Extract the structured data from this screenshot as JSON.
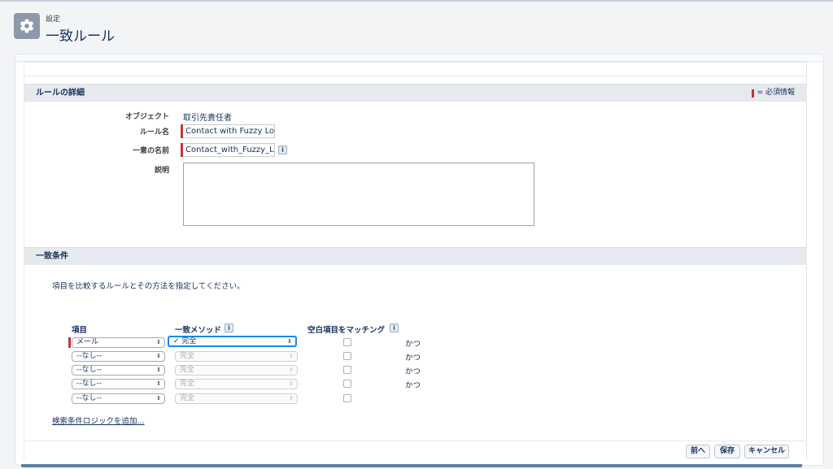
{
  "header": {
    "small": "設定",
    "title": "一致ルール"
  },
  "details_section": {
    "title": "ルールの詳細",
    "required_legend": "= 必須情報",
    "fields": {
      "object_label": "オブジェクト",
      "object_value": "取引先責任者",
      "rule_name_label": "ルール名",
      "rule_name_value": "Contact with Fuzzy Logic",
      "unique_name_label": "一意の名前",
      "unique_name_value": "Contact_with_Fuzzy_Logic",
      "description_label": "説明",
      "description_value": ""
    }
  },
  "criteria_section": {
    "title": "一致条件",
    "instruction": "項目を比較するルールとその方法を指定してください。",
    "columns": {
      "field": "項目",
      "method": "一致メソッド",
      "blank": "空白項目をマッチング"
    },
    "rows": [
      {
        "field": "メール",
        "method": "完全",
        "conj": "かつ"
      },
      {
        "field": "--なし--",
        "method": "完全",
        "conj": "かつ"
      },
      {
        "field": "--なし--",
        "method": "完全",
        "conj": "かつ"
      },
      {
        "field": "--なし--",
        "method": "完全",
        "conj": "かつ"
      },
      {
        "field": "--なし--",
        "method": "完全",
        "conj": ""
      }
    ],
    "add_logic_link": "検索条件ロジックを追加..."
  },
  "footer": {
    "prev": "前へ",
    "save": "保存",
    "cancel": "キャンセル"
  },
  "icons": {
    "gear": "gear-icon",
    "info": "info-icon",
    "checkmark": "checkmark-icon"
  },
  "colors": {
    "required": "#c23934",
    "focus": "#1589ee",
    "header_bg": "#e6e9ee"
  }
}
